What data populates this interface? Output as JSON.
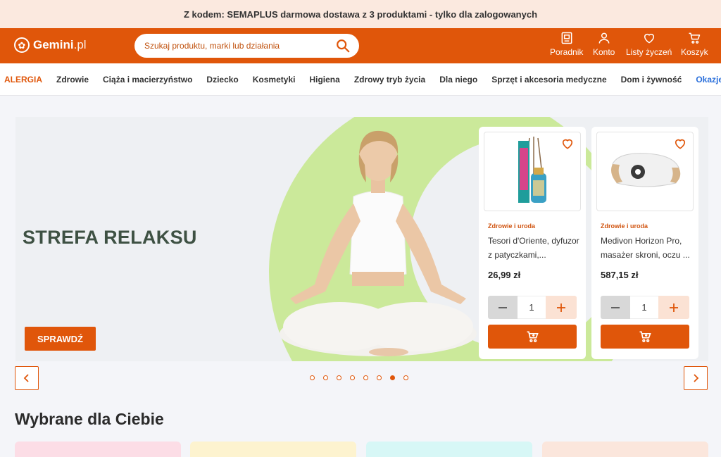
{
  "promo": {
    "text": "Z kodem: SEMAPLUS darmowa dostawa z 3 produktami - tylko dla zalogowanych"
  },
  "header": {
    "logo_main": "Gemini",
    "logo_suffix": ".pl",
    "search_placeholder": "Szukaj produktu, marki lub działania",
    "nav": [
      {
        "label": "Poradnik",
        "icon": "book-icon"
      },
      {
        "label": "Konto",
        "icon": "user-icon"
      },
      {
        "label": "Listy życzeń",
        "icon": "heart-icon"
      },
      {
        "label": "Koszyk",
        "icon": "cart-icon"
      }
    ]
  },
  "categories": [
    "ALERGIA",
    "Zdrowie",
    "Ciąża i macierzyństwo",
    "Dziecko",
    "Kosmetyki",
    "Higiena",
    "Zdrowy tryb życia",
    "Dla niego",
    "Sprzęt i akcesoria medyczne",
    "Dom i żywność",
    "Okazje"
  ],
  "banner": {
    "title": "STREFA RELAKSU",
    "cta": "SPRAWDŹ",
    "slides_count": 8,
    "active_slide": 7
  },
  "products": [
    {
      "category": "Zdrowie i uroda",
      "name": "Tesori d'Oriente, dyfuzor z patyczkami,...",
      "price": "26,99 zł",
      "qty": "1"
    },
    {
      "category": "Zdrowie i uroda",
      "name": "Medivon Horizon Pro, masażer skroni, oczu ...",
      "price": "587,15 zł",
      "qty": "1"
    }
  ],
  "section": {
    "title": "Wybrane dla Ciebie"
  },
  "colors": {
    "accent": "#e0560a",
    "promo_bg": "#fbe9df",
    "banner_green": "#cbe99a",
    "tiles": [
      "#fcdde6",
      "#fdf3cf",
      "#d7f7f6",
      "#fbe6dc"
    ]
  }
}
